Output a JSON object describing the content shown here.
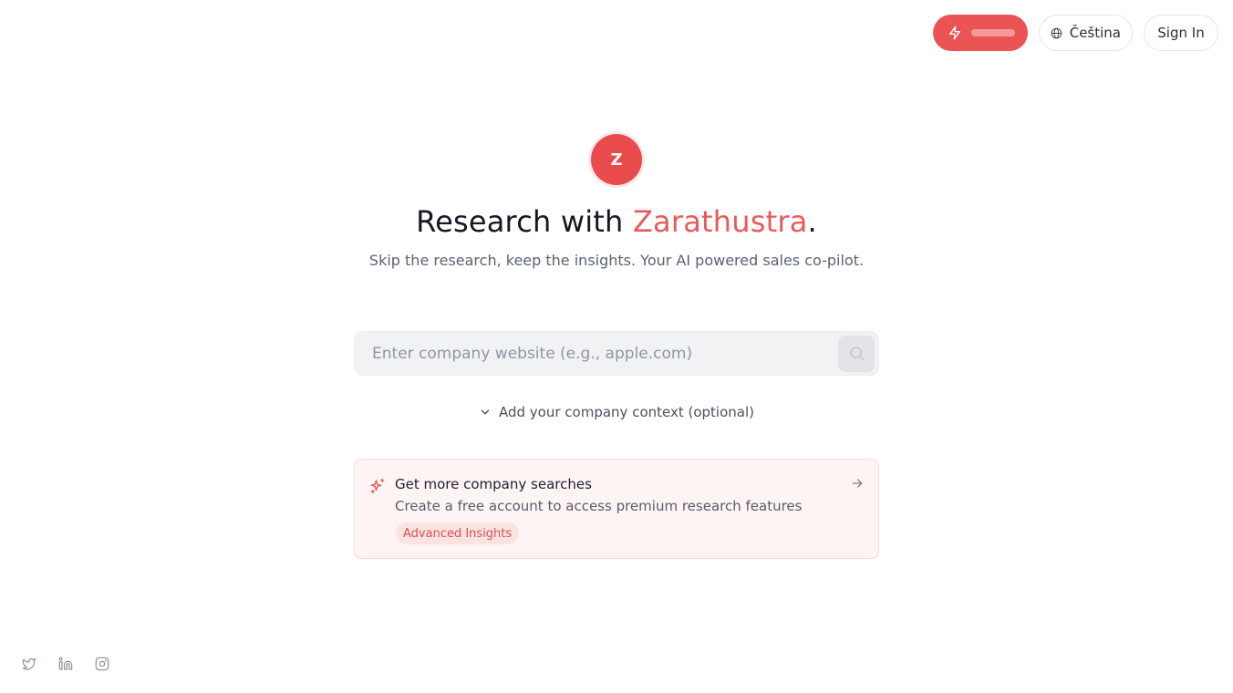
{
  "header": {
    "language_label": "Čeština",
    "signin_label": "Sign In",
    "credits_icon": "bolt-icon",
    "language_icon": "globe-icon"
  },
  "hero": {
    "logo_letter": "Z",
    "title_prefix": "Research with ",
    "title_brand": "Zarathustra",
    "title_suffix": ".",
    "subtitle": "Skip the research, keep the insights. Your AI powered sales co-pilot."
  },
  "search": {
    "placeholder": "Enter company website (e.g., apple.com)",
    "value": "",
    "button_icon": "search-icon"
  },
  "context_toggle": {
    "label": "Add your company context (optional)",
    "icon": "chevron-down-icon"
  },
  "promo": {
    "title": "Get more company searches",
    "description": "Create a free account to access premium research features",
    "tag": "Advanced Insights",
    "icon": "sparkles-icon",
    "arrow_icon": "arrow-right-icon"
  },
  "social": [
    "twitter-icon",
    "linkedin-icon",
    "instagram-icon"
  ],
  "colors": {
    "accent": "#ea5455",
    "brand_text": "#e85a5a",
    "promo_bg": "#fef4f3",
    "tag_bg": "#fbe3e2",
    "tag_text": "#dc4f4f"
  }
}
